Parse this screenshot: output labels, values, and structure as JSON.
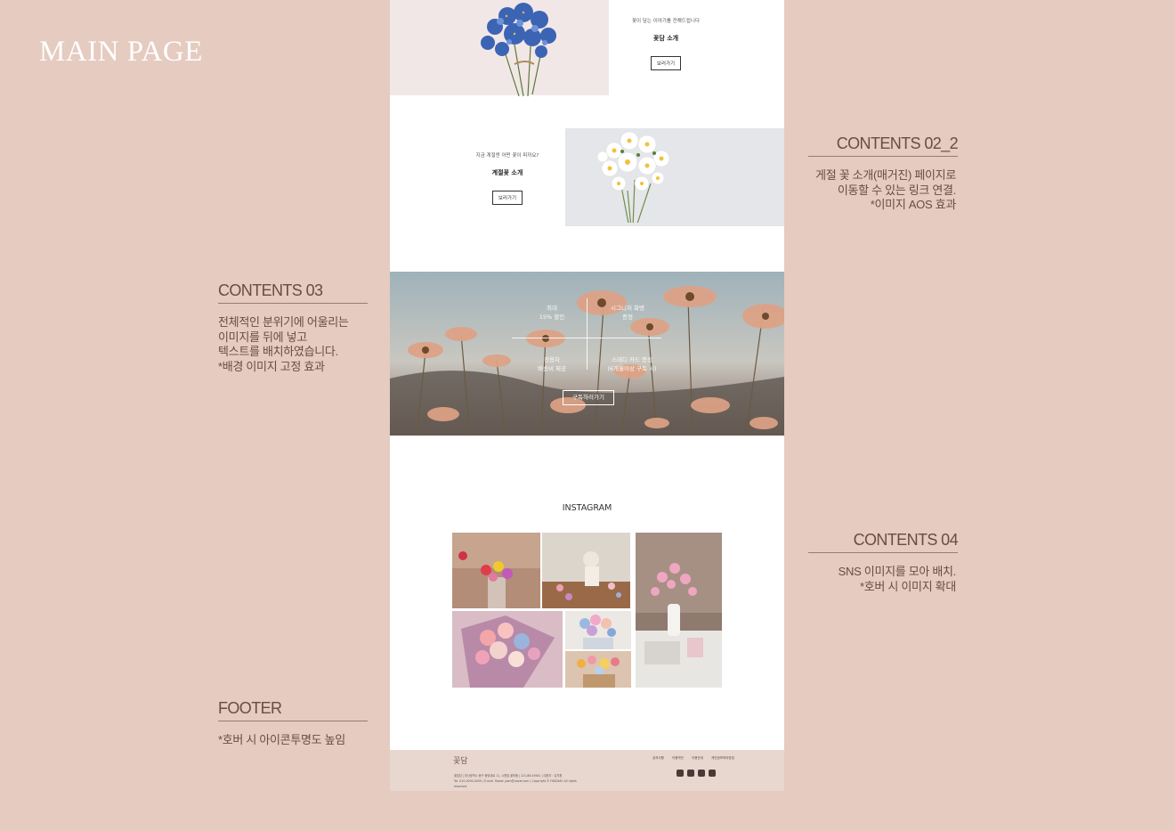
{
  "page_title": "MAIN PAGE",
  "annotations": {
    "contents_02_2": {
      "heading": "CONTENTS 02_2",
      "lines": [
        "게절 꽃 소개(매거진) 페이지로",
        "이동할 수 있는 링크 연결.",
        "*이미지 AOS 효과"
      ]
    },
    "contents_03": {
      "heading": "CONTENTS 03",
      "lines": [
        "전체적인 분위기에 어울리는",
        "이미지를 뒤에 넣고",
        "텍스트를 배치하였습니다.",
        "*배경 이미지 고정 효과"
      ]
    },
    "contents_04": {
      "heading": "CONTENTS 04",
      "lines": [
        "SNS 이미지를 모아 배치.",
        "*호버 시 이미지 확대"
      ]
    },
    "footer": {
      "heading": "FOOTER",
      "lines": [
        "*호버 시 아이콘투명도 높임"
      ]
    }
  },
  "mockup": {
    "story1": {
      "sub": "꽃이 담는 이야기를 전해드립니다",
      "title": "꽃담 소개",
      "button": "보러가기"
    },
    "story2": {
      "sub": "지금 계절엔 어떤 꽃이 피까요?",
      "title": "계절꽃 소개",
      "button": "보러가기"
    },
    "hero": {
      "items": [
        {
          "line1": "최대",
          "line2": "15% 할인"
        },
        {
          "line1": "시그니처 화병",
          "line2": "증정"
        },
        {
          "line1": "전용차",
          "line2": "배송비 제공"
        },
        {
          "line1": "스태디 카드 증정",
          "line2": "(6개월이상 구독 시)"
        }
      ],
      "button": "구독하러가기"
    },
    "instagram_title": "INSTAGRAM",
    "footer": {
      "logo": "꽃담",
      "info_line1": "꽃집담 | 부산광역시 동구 중앙대로 11, 시원빌 꽃보물 | 121-86-45641 | 대표자 : 김지원",
      "info_line2": "Tel. 010-0000-0000 | E-mail. flower_dam@naver.com | Copyright © FKKDAM. All rights reserved.",
      "links": [
        "공지사항",
        "이용약관",
        "이용안내",
        "개인정보처리방침"
      ],
      "social_icons": [
        "facebook-icon",
        "instagram-icon",
        "twitter-icon",
        "youtube-icon"
      ]
    }
  },
  "colors": {
    "background": "#e5cbc0",
    "accent_text": "#6b4c43",
    "footer_bg": "#e8d7cf"
  }
}
